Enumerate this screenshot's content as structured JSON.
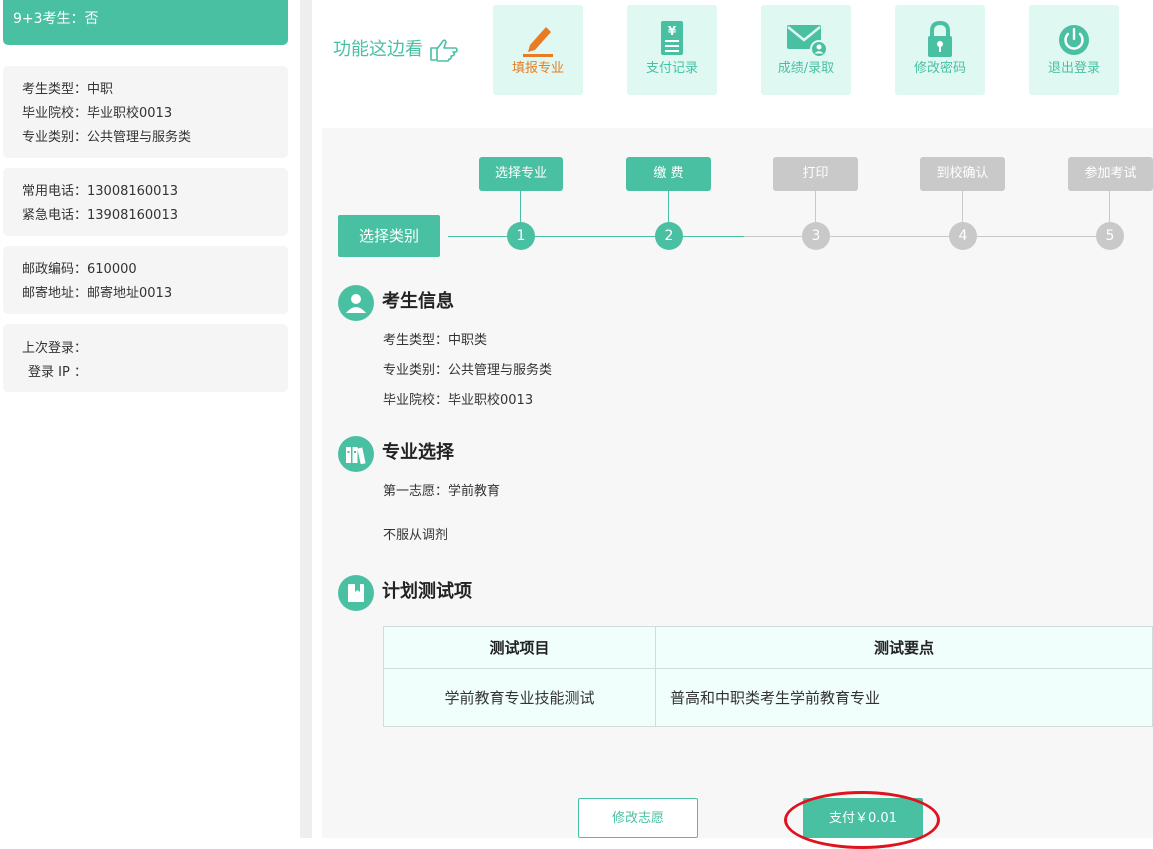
{
  "sidebar": {
    "top_line": "9+3考生：否",
    "block1": [
      "考生类型：中职",
      "毕业院校：毕业职校0013",
      "专业类别：公共管理与服务类"
    ],
    "block2": [
      "常用电话：13008160013",
      "紧急电话：13908160013"
    ],
    "block3": [
      "邮政编码：610000",
      "邮寄地址：邮寄地址0013"
    ],
    "block4": [
      "上次登录：",
      "登录 IP ："
    ]
  },
  "func_bar": {
    "title": "功能这边看",
    "tiles": [
      {
        "label": "填报专业",
        "icon": "pencil-icon",
        "active": true
      },
      {
        "label": "支付记录",
        "icon": "receipt-icon",
        "active": false
      },
      {
        "label": "成绩/录取",
        "icon": "mail-user-icon",
        "active": false
      },
      {
        "label": "修改密码",
        "icon": "lock-icon",
        "active": false
      },
      {
        "label": "退出登录",
        "icon": "power-icon",
        "active": false
      }
    ]
  },
  "steps": {
    "category_button": "选择类别",
    "items": [
      {
        "label": "选择专业",
        "num": "1",
        "status": "done"
      },
      {
        "label": "缴 费",
        "num": "2",
        "status": "done"
      },
      {
        "label": "打印",
        "num": "3",
        "status": "todo"
      },
      {
        "label": "到校确认",
        "num": "4",
        "status": "todo"
      },
      {
        "label": "参加考试",
        "num": "5",
        "status": "todo"
      }
    ]
  },
  "candidate_info": {
    "title": "考生信息",
    "lines": [
      "考生类型：中职类",
      "专业类别：公共管理与服务类",
      "毕业院校：毕业职校0013"
    ]
  },
  "major_selection": {
    "title": "专业选择",
    "first_choice": "第一志愿：学前教育",
    "adjust": "不服从调剂"
  },
  "plan_tests": {
    "title": "计划测试项",
    "headers": [
      "测试项目",
      "测试要点"
    ],
    "rows": [
      [
        "学前教育专业技能测试",
        "普高和中职类考生学前教育专业"
      ]
    ]
  },
  "buttons": {
    "modify": "修改志愿",
    "pay": "支付￥0.01"
  },
  "colors": {
    "accent": "#4ac0a3",
    "inactive": "#c9c9c9",
    "active_text": "#e87c23",
    "highlight": "#e0121e"
  }
}
